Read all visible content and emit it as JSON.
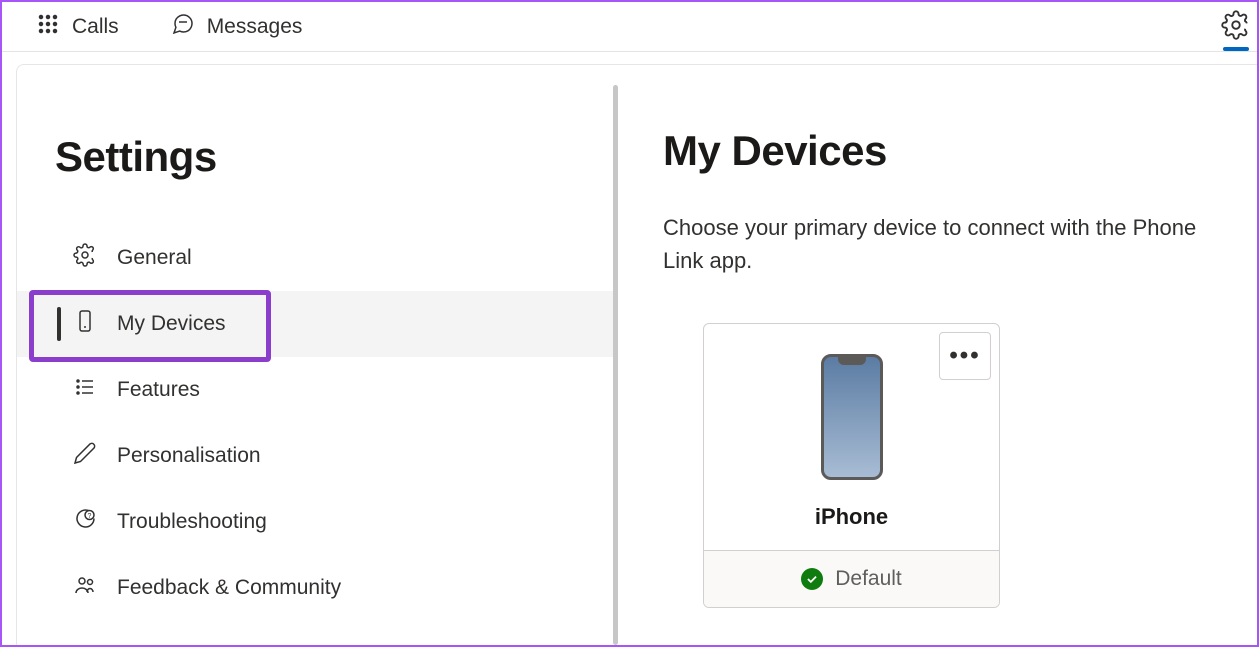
{
  "topbar": {
    "tabs": [
      {
        "label": "Calls"
      },
      {
        "label": "Messages"
      }
    ]
  },
  "sidebar": {
    "title": "Settings",
    "items": [
      {
        "label": "General"
      },
      {
        "label": "My Devices"
      },
      {
        "label": "Features"
      },
      {
        "label": "Personalisation"
      },
      {
        "label": "Troubleshooting"
      },
      {
        "label": "Feedback & Community"
      }
    ]
  },
  "main": {
    "title": "My Devices",
    "description": "Choose your primary device to connect with the Phone Link app.",
    "device": {
      "name": "iPhone",
      "status": "Default"
    }
  }
}
